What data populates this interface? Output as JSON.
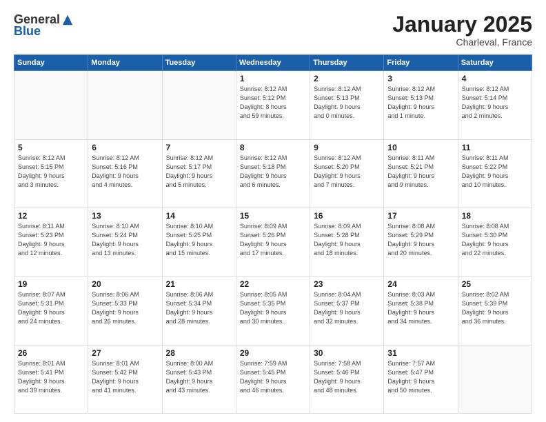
{
  "logo": {
    "general": "General",
    "blue": "Blue"
  },
  "header": {
    "month": "January 2025",
    "location": "Charleval, France"
  },
  "weekdays": [
    "Sunday",
    "Monday",
    "Tuesday",
    "Wednesday",
    "Thursday",
    "Friday",
    "Saturday"
  ],
  "weeks": [
    [
      {
        "day": "",
        "info": ""
      },
      {
        "day": "",
        "info": ""
      },
      {
        "day": "",
        "info": ""
      },
      {
        "day": "1",
        "info": "Sunrise: 8:12 AM\nSunset: 5:12 PM\nDaylight: 8 hours\nand 59 minutes."
      },
      {
        "day": "2",
        "info": "Sunrise: 8:12 AM\nSunset: 5:13 PM\nDaylight: 9 hours\nand 0 minutes."
      },
      {
        "day": "3",
        "info": "Sunrise: 8:12 AM\nSunset: 5:13 PM\nDaylight: 9 hours\nand 1 minute."
      },
      {
        "day": "4",
        "info": "Sunrise: 8:12 AM\nSunset: 5:14 PM\nDaylight: 9 hours\nand 2 minutes."
      }
    ],
    [
      {
        "day": "5",
        "info": "Sunrise: 8:12 AM\nSunset: 5:15 PM\nDaylight: 9 hours\nand 3 minutes."
      },
      {
        "day": "6",
        "info": "Sunrise: 8:12 AM\nSunset: 5:16 PM\nDaylight: 9 hours\nand 4 minutes."
      },
      {
        "day": "7",
        "info": "Sunrise: 8:12 AM\nSunset: 5:17 PM\nDaylight: 9 hours\nand 5 minutes."
      },
      {
        "day": "8",
        "info": "Sunrise: 8:12 AM\nSunset: 5:18 PM\nDaylight: 9 hours\nand 6 minutes."
      },
      {
        "day": "9",
        "info": "Sunrise: 8:12 AM\nSunset: 5:20 PM\nDaylight: 9 hours\nand 7 minutes."
      },
      {
        "day": "10",
        "info": "Sunrise: 8:11 AM\nSunset: 5:21 PM\nDaylight: 9 hours\nand 9 minutes."
      },
      {
        "day": "11",
        "info": "Sunrise: 8:11 AM\nSunset: 5:22 PM\nDaylight: 9 hours\nand 10 minutes."
      }
    ],
    [
      {
        "day": "12",
        "info": "Sunrise: 8:11 AM\nSunset: 5:23 PM\nDaylight: 9 hours\nand 12 minutes."
      },
      {
        "day": "13",
        "info": "Sunrise: 8:10 AM\nSunset: 5:24 PM\nDaylight: 9 hours\nand 13 minutes."
      },
      {
        "day": "14",
        "info": "Sunrise: 8:10 AM\nSunset: 5:25 PM\nDaylight: 9 hours\nand 15 minutes."
      },
      {
        "day": "15",
        "info": "Sunrise: 8:09 AM\nSunset: 5:26 PM\nDaylight: 9 hours\nand 17 minutes."
      },
      {
        "day": "16",
        "info": "Sunrise: 8:09 AM\nSunset: 5:28 PM\nDaylight: 9 hours\nand 18 minutes."
      },
      {
        "day": "17",
        "info": "Sunrise: 8:08 AM\nSunset: 5:29 PM\nDaylight: 9 hours\nand 20 minutes."
      },
      {
        "day": "18",
        "info": "Sunrise: 8:08 AM\nSunset: 5:30 PM\nDaylight: 9 hours\nand 22 minutes."
      }
    ],
    [
      {
        "day": "19",
        "info": "Sunrise: 8:07 AM\nSunset: 5:31 PM\nDaylight: 9 hours\nand 24 minutes."
      },
      {
        "day": "20",
        "info": "Sunrise: 8:06 AM\nSunset: 5:33 PM\nDaylight: 9 hours\nand 26 minutes."
      },
      {
        "day": "21",
        "info": "Sunrise: 8:06 AM\nSunset: 5:34 PM\nDaylight: 9 hours\nand 28 minutes."
      },
      {
        "day": "22",
        "info": "Sunrise: 8:05 AM\nSunset: 5:35 PM\nDaylight: 9 hours\nand 30 minutes."
      },
      {
        "day": "23",
        "info": "Sunrise: 8:04 AM\nSunset: 5:37 PM\nDaylight: 9 hours\nand 32 minutes."
      },
      {
        "day": "24",
        "info": "Sunrise: 8:03 AM\nSunset: 5:38 PM\nDaylight: 9 hours\nand 34 minutes."
      },
      {
        "day": "25",
        "info": "Sunrise: 8:02 AM\nSunset: 5:39 PM\nDaylight: 9 hours\nand 36 minutes."
      }
    ],
    [
      {
        "day": "26",
        "info": "Sunrise: 8:01 AM\nSunset: 5:41 PM\nDaylight: 9 hours\nand 39 minutes."
      },
      {
        "day": "27",
        "info": "Sunrise: 8:01 AM\nSunset: 5:42 PM\nDaylight: 9 hours\nand 41 minutes."
      },
      {
        "day": "28",
        "info": "Sunrise: 8:00 AM\nSunset: 5:43 PM\nDaylight: 9 hours\nand 43 minutes."
      },
      {
        "day": "29",
        "info": "Sunrise: 7:59 AM\nSunset: 5:45 PM\nDaylight: 9 hours\nand 46 minutes."
      },
      {
        "day": "30",
        "info": "Sunrise: 7:58 AM\nSunset: 5:46 PM\nDaylight: 9 hours\nand 48 minutes."
      },
      {
        "day": "31",
        "info": "Sunrise: 7:57 AM\nSunset: 5:47 PM\nDaylight: 9 hours\nand 50 minutes."
      },
      {
        "day": "",
        "info": ""
      }
    ]
  ]
}
